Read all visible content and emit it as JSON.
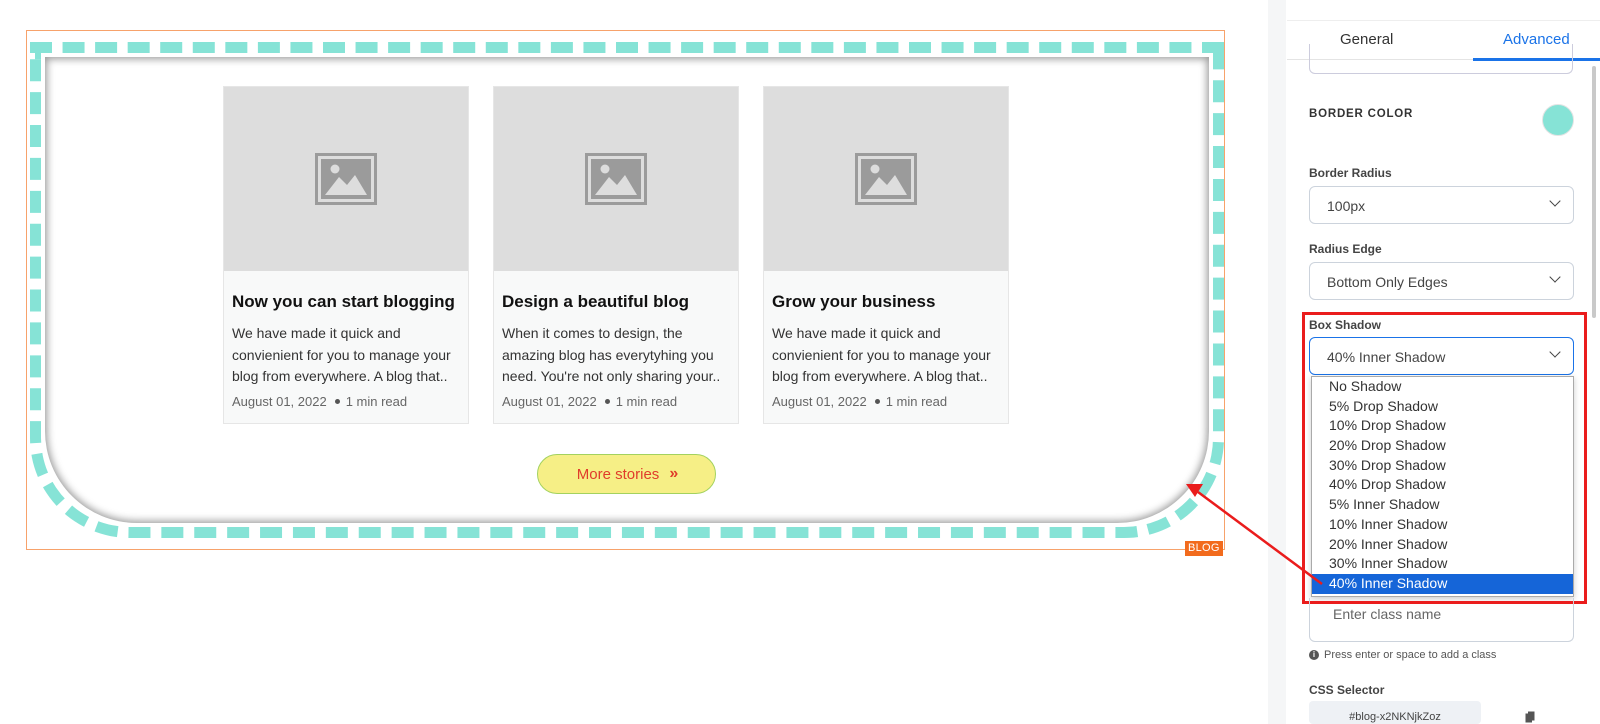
{
  "canvas": {
    "blog_tag": "BLOG",
    "cards": [
      {
        "title": "Now you can start blogging",
        "description": "We have made it quick and convienient for you to manage your blog from everywhere. A blog that..",
        "date": "August 01, 2022",
        "read_time": "1 min read"
      },
      {
        "title": "Design a beautiful blog",
        "description": "When it comes to design, the amazing blog has everytyhing you need. You're not only sharing your..",
        "date": "August 01, 2022",
        "read_time": "1 min read"
      },
      {
        "title": "Grow your business",
        "description": "We have made it quick and convienient for you to manage your blog from everywhere. A blog that..",
        "date": "August 01, 2022",
        "read_time": "1 min read"
      }
    ],
    "more_button": {
      "label": "More stories",
      "icon": "double-chevron-right-icon",
      "icon_glyph": "»"
    }
  },
  "panel": {
    "tabs": [
      {
        "label": "General",
        "active": false
      },
      {
        "label": "Advanced",
        "active": true
      }
    ],
    "border_color_label": "BORDER COLOR",
    "border_color_value": "#86e3d6",
    "border_radius": {
      "label": "Border Radius",
      "value": "100px"
    },
    "radius_edge": {
      "label": "Radius Edge",
      "value": "Bottom Only Edges"
    },
    "box_shadow": {
      "label": "Box Shadow",
      "value": "40% Inner Shadow",
      "options": [
        "No Shadow",
        "5% Drop Shadow",
        "10% Drop Shadow",
        "20% Drop Shadow",
        "30% Drop Shadow",
        "40% Drop Shadow",
        "5% Inner Shadow",
        "10% Inner Shadow",
        "20% Inner Shadow",
        "30% Inner Shadow",
        "40% Inner Shadow"
      ],
      "selected_index": 10
    },
    "class_input": {
      "placeholder": "Enter class name"
    },
    "class_hint": "Press enter or space to add a class",
    "css_selector": {
      "label": "CSS Selector",
      "value": "#blog-x2NKNjkZoz"
    }
  },
  "colors": {
    "accent": "#1a73e8",
    "border_teal": "#86e3d6",
    "button_fill": "#f6ef86",
    "button_text": "#e03c2b",
    "annotation_red": "#ea1c1c",
    "blog_tag": "#f26b1d"
  }
}
